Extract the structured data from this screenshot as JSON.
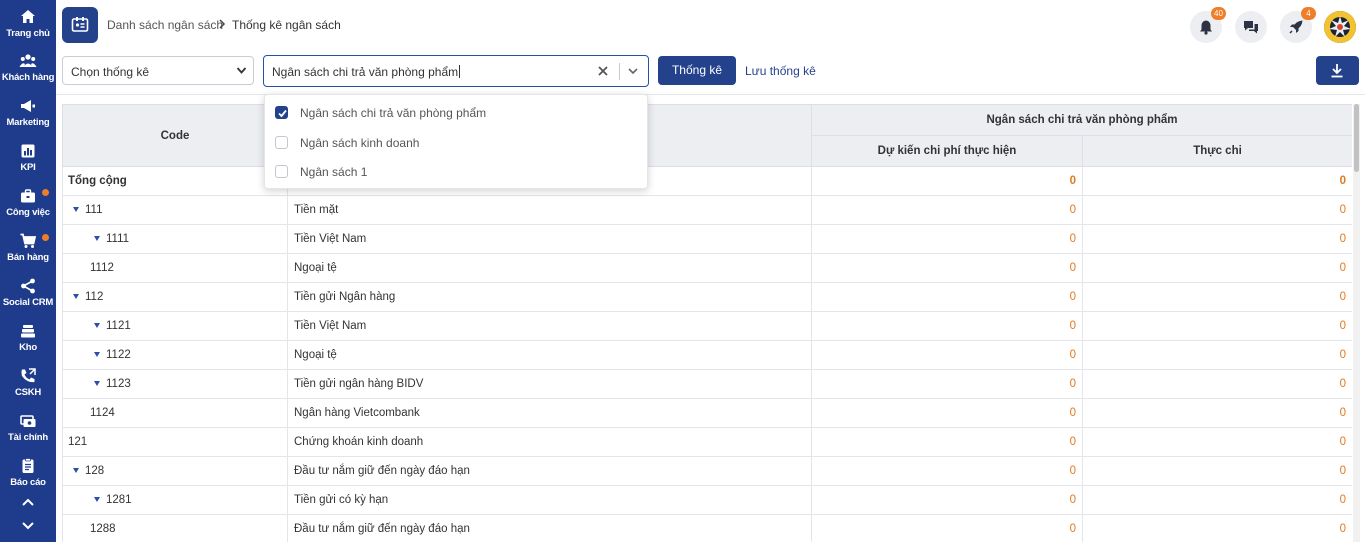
{
  "sidebar": {
    "items": [
      {
        "label": "Trang chủ",
        "icon": "home-icon"
      },
      {
        "label": "Khách hàng",
        "icon": "customers-icon"
      },
      {
        "label": "Marketing",
        "icon": "megaphone-icon"
      },
      {
        "label": "KPI",
        "icon": "chart-icon"
      },
      {
        "label": "Công việc",
        "icon": "briefcase-icon"
      },
      {
        "label": "Bán hàng",
        "icon": "cart-icon"
      },
      {
        "label": "Social CRM",
        "icon": "share-icon"
      },
      {
        "label": "Kho",
        "icon": "warehouse-icon"
      },
      {
        "label": "CSKH",
        "icon": "phone-icon"
      },
      {
        "label": "Tài chính",
        "icon": "money-icon"
      },
      {
        "label": "Báo cáo",
        "icon": "clipboard-icon"
      }
    ]
  },
  "header": {
    "breadcrumb": {
      "parent": "Danh sách ngân sách",
      "separator": ">",
      "current": "Thống kê ngân sách"
    },
    "notifications_count": "40",
    "rocket_count": "4"
  },
  "toolbar": {
    "stat_select_placeholder": "Chọn thống kê",
    "multi_select_value": "Ngân sách chi trả văn phòng phẩm",
    "stat_button": "Thống kê",
    "save_link": "Lưu thống kê"
  },
  "dropdown": {
    "options": [
      {
        "label": "Ngân sách chi trả văn phòng phẩm",
        "checked": true
      },
      {
        "label": "Ngân sách kinh doanh",
        "checked": false
      },
      {
        "label": "Ngân sách 1",
        "checked": false
      }
    ]
  },
  "table": {
    "col_code": "Code",
    "group_header": "Ngân sách chi trả văn phòng phẩm",
    "col_planned": "Dự kiến chi phí thực hiện",
    "col_actual": "Thực chi",
    "rows": [
      {
        "code": "Tổng cộng",
        "name": "",
        "planned": "0",
        "actual": "0",
        "indent": 0,
        "expand": false,
        "total": true
      },
      {
        "code": "111",
        "name": "Tiền mặt",
        "planned": "0",
        "actual": "0",
        "indent": 1,
        "expand": true
      },
      {
        "code": "1111",
        "name": "Tiền Việt Nam",
        "planned": "0",
        "actual": "0",
        "indent": 2,
        "expand": true
      },
      {
        "code": "1112",
        "name": "Ngoại tệ",
        "planned": "0",
        "actual": "0",
        "indent": 2,
        "expand": false
      },
      {
        "code": "112",
        "name": "Tiền gửi Ngân hàng",
        "planned": "0",
        "actual": "0",
        "indent": 1,
        "expand": true
      },
      {
        "code": "1121",
        "name": "Tiền Việt Nam",
        "planned": "0",
        "actual": "0",
        "indent": 2,
        "expand": true
      },
      {
        "code": "1122",
        "name": "Ngoại tệ",
        "planned": "0",
        "actual": "0",
        "indent": 2,
        "expand": true
      },
      {
        "code": "1123",
        "name": "Tiền gửi ngân hàng BIDV",
        "planned": "0",
        "actual": "0",
        "indent": 2,
        "expand": true
      },
      {
        "code": "1124",
        "name": "Ngân hàng Vietcombank",
        "planned": "0",
        "actual": "0",
        "indent": 2,
        "expand": false
      },
      {
        "code": "121",
        "name": "Chứng khoán kinh doanh",
        "planned": "0",
        "actual": "0",
        "indent": 0,
        "expand": false
      },
      {
        "code": "128",
        "name": "Đầu tư nắm giữ đến ngày đáo hạn",
        "planned": "0",
        "actual": "0",
        "indent": 1,
        "expand": true
      },
      {
        "code": "1281",
        "name": "Tiền gửi có kỳ hạn",
        "planned": "0",
        "actual": "0",
        "indent": 2,
        "expand": true
      },
      {
        "code": "1288",
        "name": "Đầu tư nắm giữ đến ngày đáo hạn",
        "planned": "0",
        "actual": "0",
        "indent": 2,
        "expand": false
      }
    ]
  },
  "colors": {
    "sidebar": "#1f3c8c",
    "primary": "#24428c",
    "accent": "#f07d28",
    "value": "#e07a1f"
  }
}
